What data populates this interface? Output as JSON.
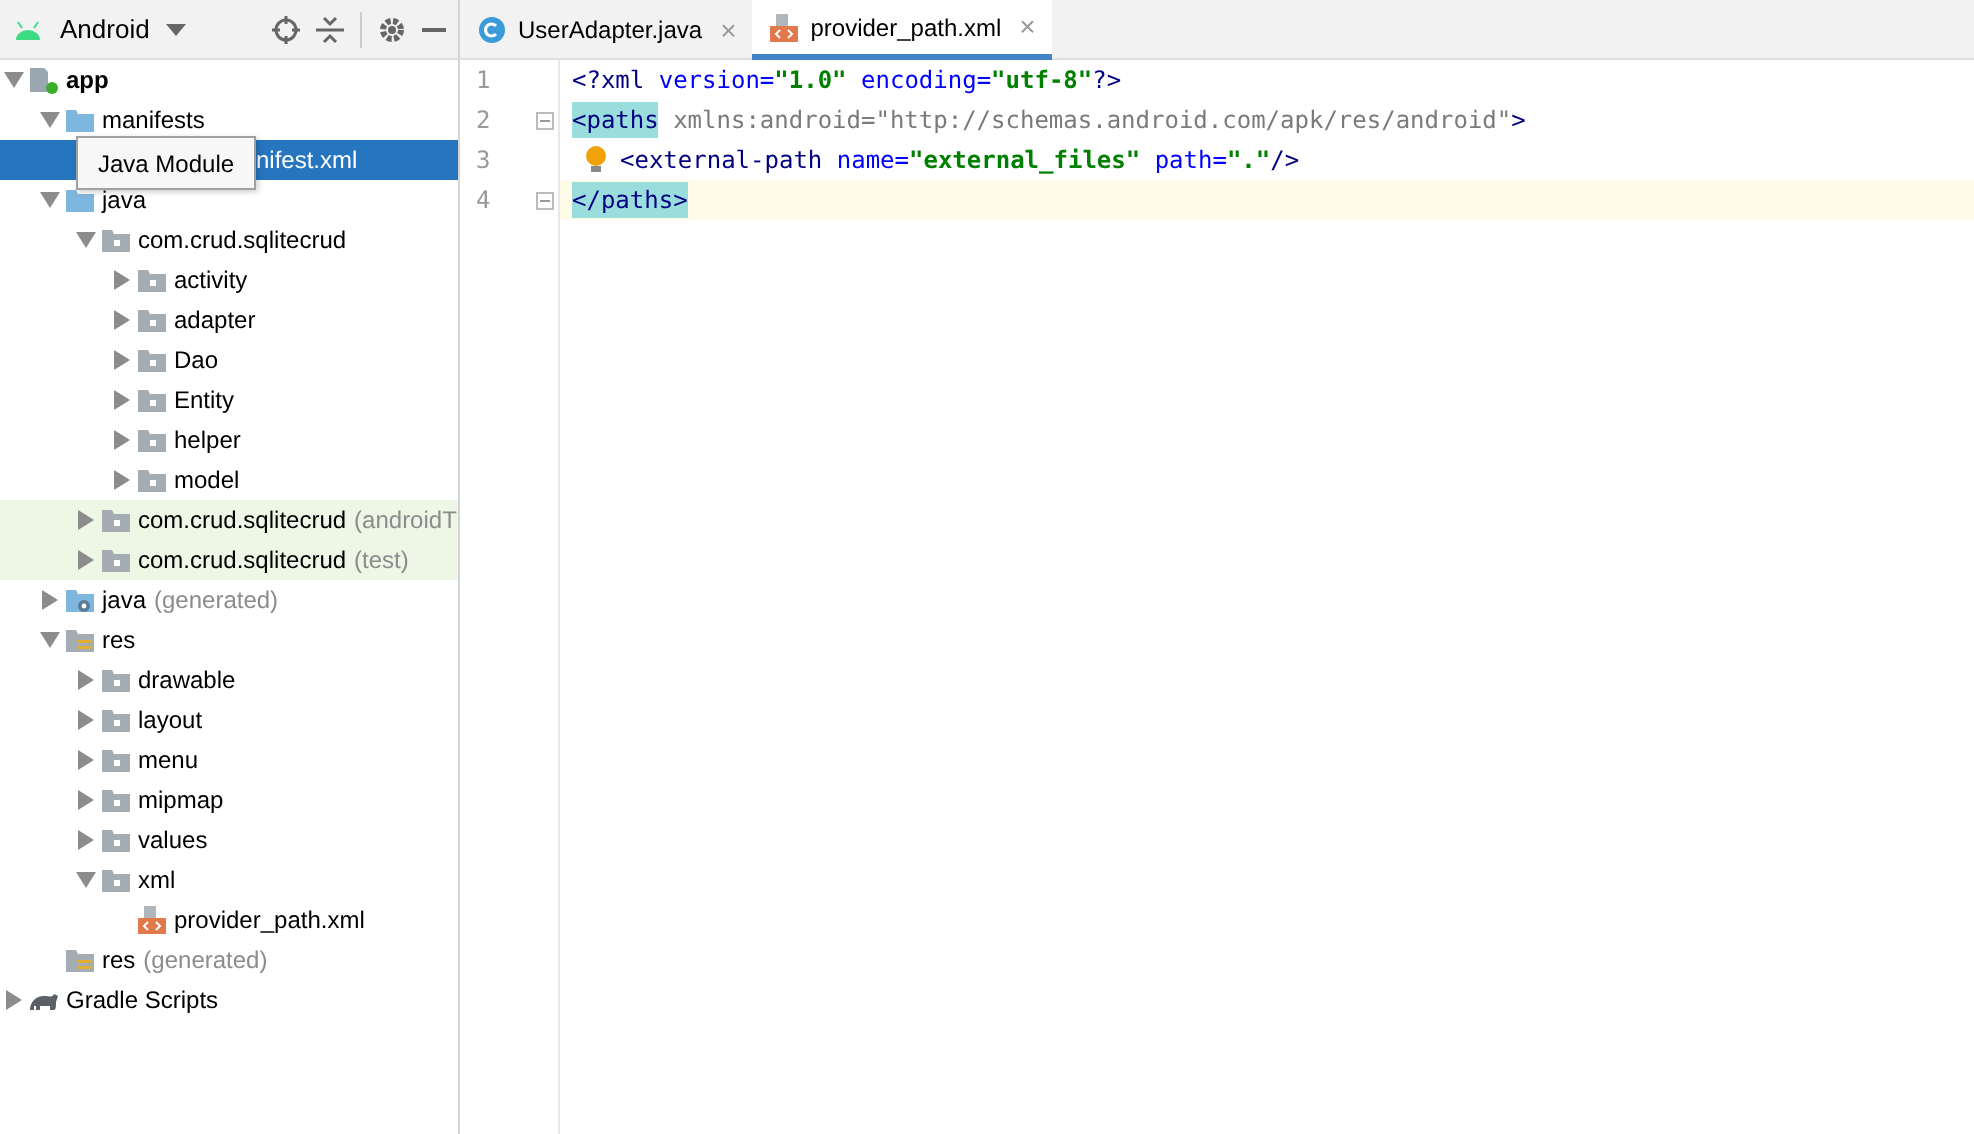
{
  "project_panel": {
    "view_name": "Android",
    "tooltip": "Java Module",
    "tree": [
      {
        "label": "app",
        "kind": "module",
        "expanded": true,
        "children": [
          {
            "label": "manifests",
            "kind": "source-folder",
            "expanded": true,
            "children": [
              {
                "label": "nifest.xml",
                "kind": "covered",
                "selected": true
              }
            ]
          },
          {
            "label": "java",
            "kind": "source-folder",
            "expanded": true,
            "children": [
              {
                "label": "com.crud.sqlitecrud",
                "kind": "package",
                "expanded": true,
                "children": [
                  {
                    "label": "activity",
                    "kind": "package",
                    "expanded": false
                  },
                  {
                    "label": "adapter",
                    "kind": "package",
                    "expanded": false
                  },
                  {
                    "label": "Dao",
                    "kind": "package",
                    "expanded": false
                  },
                  {
                    "label": "Entity",
                    "kind": "package",
                    "expanded": false
                  },
                  {
                    "label": "helper",
                    "kind": "package",
                    "expanded": false
                  },
                  {
                    "label": "model",
                    "kind": "package",
                    "expanded": false
                  }
                ]
              },
              {
                "label": "com.crud.sqlitecrud",
                "suffix": "(androidT",
                "kind": "package",
                "expanded": false,
                "test_source": true
              },
              {
                "label": "com.crud.sqlitecrud",
                "suffix": "(test)",
                "kind": "package",
                "expanded": false,
                "test_source": true
              }
            ]
          },
          {
            "label": "java",
            "suffix": "(generated)",
            "kind": "generated-folder",
            "expanded": false
          },
          {
            "label": "res",
            "kind": "resource-folder",
            "expanded": true,
            "children": [
              {
                "label": "drawable",
                "kind": "package",
                "expanded": false
              },
              {
                "label": "layout",
                "kind": "package",
                "expanded": false
              },
              {
                "label": "menu",
                "kind": "package",
                "expanded": false
              },
              {
                "label": "mipmap",
                "kind": "package",
                "expanded": false
              },
              {
                "label": "values",
                "kind": "package",
                "expanded": false
              },
              {
                "label": "xml",
                "kind": "package",
                "expanded": true,
                "children": [
                  {
                    "label": "provider_path.xml",
                    "kind": "xml-file"
                  }
                ]
              }
            ]
          },
          {
            "label": "res",
            "suffix": "(generated)",
            "kind": "resource-folder"
          }
        ]
      },
      {
        "label": "Gradle Scripts",
        "kind": "gradle",
        "expanded": false
      }
    ]
  },
  "editor": {
    "tabs": [
      {
        "label": "UserAdapter.java",
        "kind": "java-class",
        "close": "×",
        "selected": false
      },
      {
        "label": "provider_path.xml",
        "kind": "xml-file",
        "close": "×",
        "selected": true
      }
    ],
    "lines": [
      {
        "number": "1",
        "current": false,
        "bulb": false,
        "fold": false,
        "tokens": [
          {
            "kind": "punct",
            "text": "<?"
          },
          {
            "kind": "tag",
            "text": "xml "
          },
          {
            "kind": "attr",
            "text": "version="
          },
          {
            "kind": "value",
            "text": "\"1.0\" "
          },
          {
            "kind": "attr",
            "text": "encoding="
          },
          {
            "kind": "value",
            "text": "\"utf-8\""
          },
          {
            "kind": "punct",
            "text": "?>"
          }
        ]
      },
      {
        "number": "2",
        "current": false,
        "bulb": false,
        "fold": true,
        "tokens": [
          {
            "kind": "tag",
            "text": "<paths",
            "matched": true
          },
          {
            "kind": "ns",
            "text": " xmlns:android=\"http://schemas.android.com/apk/res/android\""
          },
          {
            "kind": "tag",
            "text": ">"
          }
        ]
      },
      {
        "number": "3",
        "current": false,
        "bulb": true,
        "fold": false,
        "tokens": [
          {
            "kind": "tag",
            "text": "<external-path "
          },
          {
            "kind": "attr",
            "text": "name="
          },
          {
            "kind": "value",
            "text": "\"external_files\" "
          },
          {
            "kind": "attr",
            "text": "path="
          },
          {
            "kind": "value",
            "text": "\".\""
          },
          {
            "kind": "tag",
            "text": "/>"
          }
        ]
      },
      {
        "number": "4",
        "current": true,
        "bulb": false,
        "fold": true,
        "tokens": [
          {
            "kind": "tag",
            "text": "</paths>",
            "matched": true
          }
        ]
      }
    ]
  }
}
